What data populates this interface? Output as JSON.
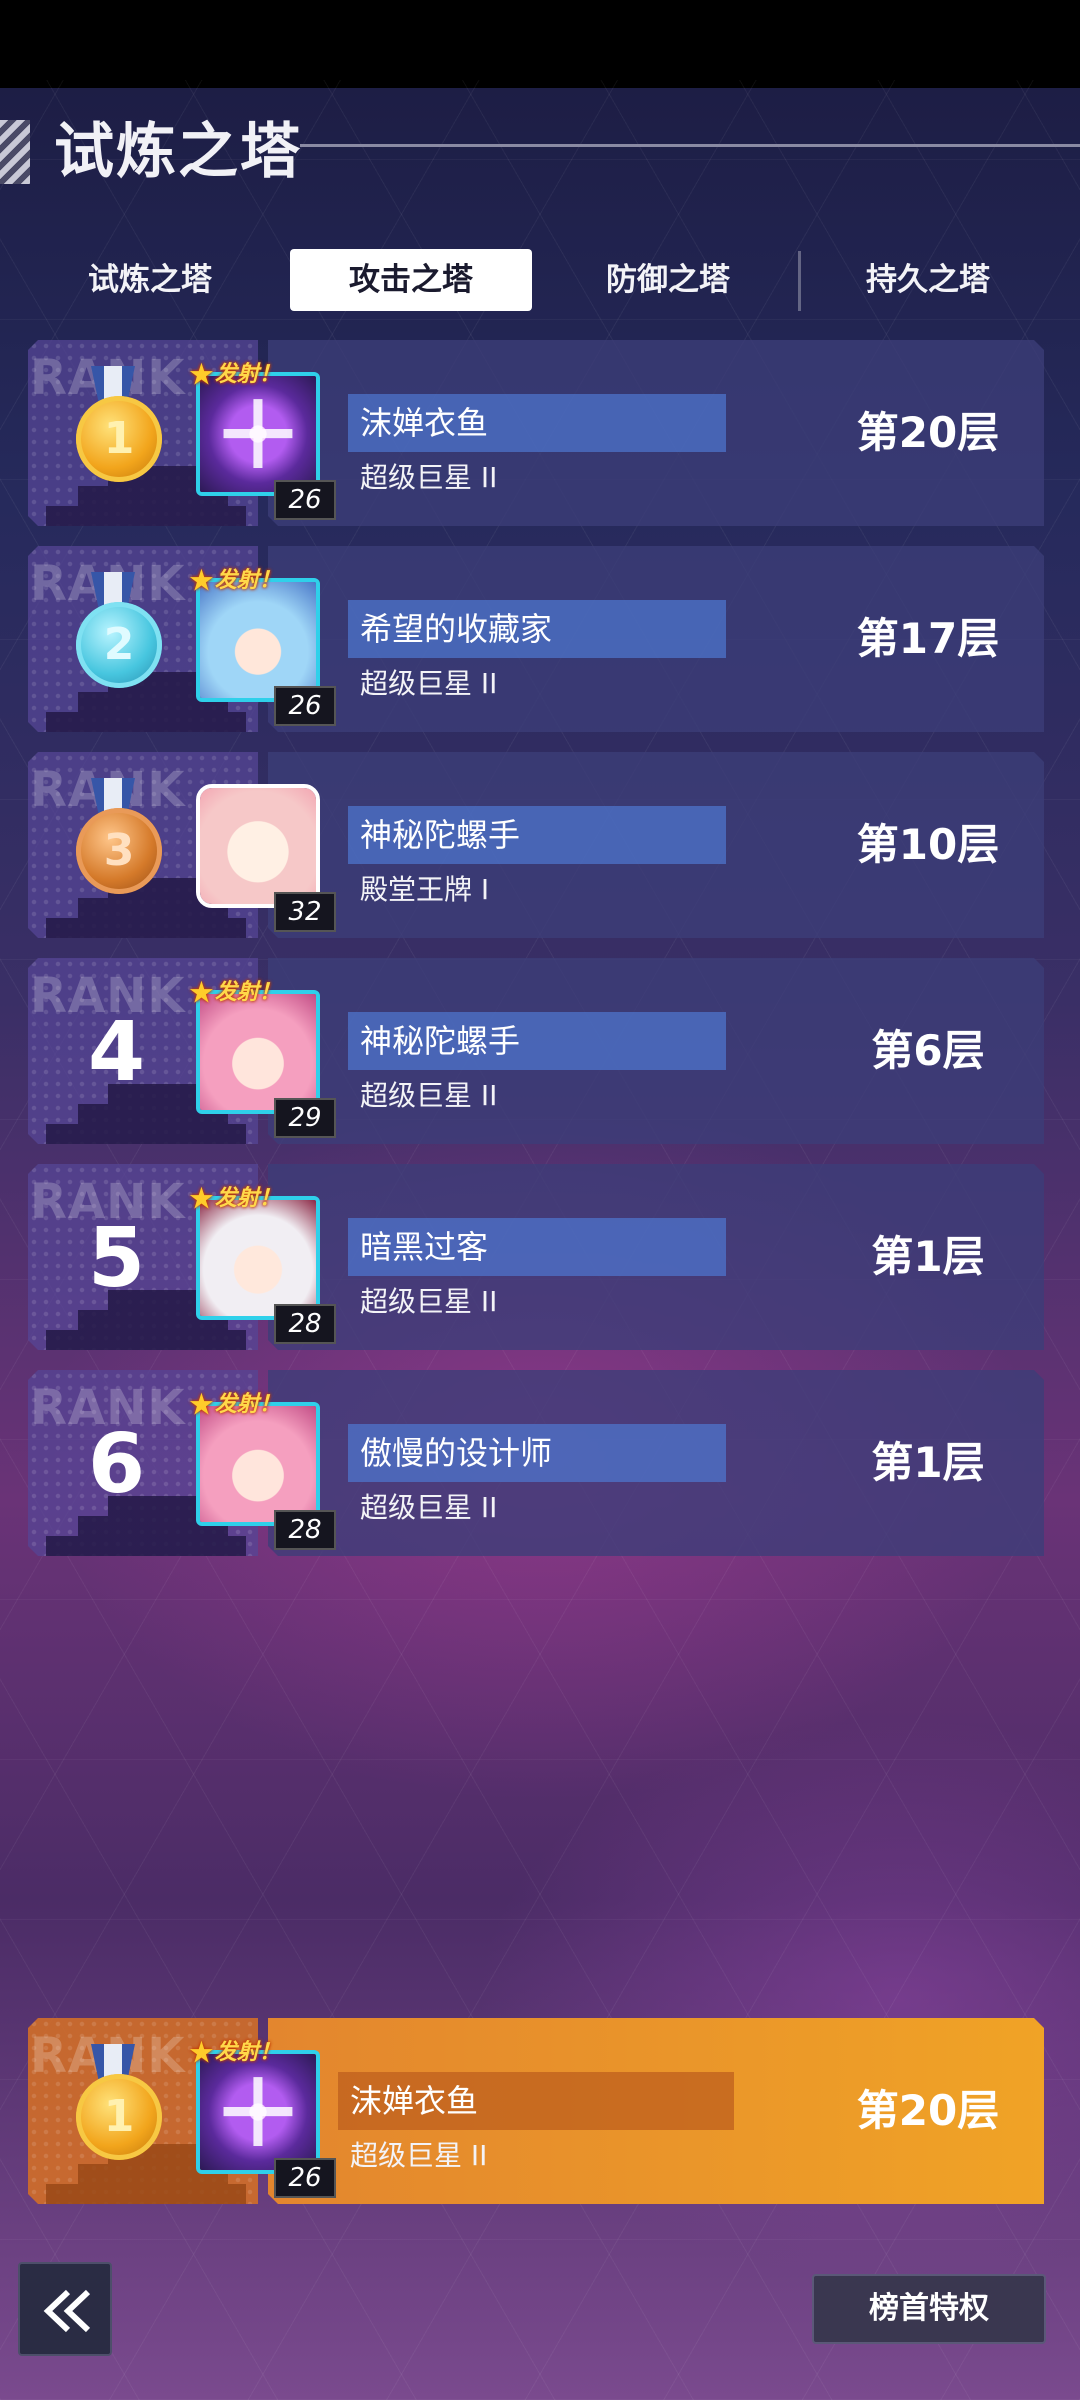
{
  "header": {
    "title": "试炼之塔"
  },
  "tabs": [
    {
      "label": "试炼之塔",
      "active": false
    },
    {
      "label": "攻击之塔",
      "active": true
    },
    {
      "label": "防御之塔",
      "active": false
    },
    {
      "label": "持久之塔",
      "active": false
    }
  ],
  "rank_watermark": "RANK",
  "hot_tag": "发射！",
  "rows": [
    {
      "rank": "1",
      "medal": "gold",
      "name": "沫婵衣鱼",
      "tier": "超级巨星 II",
      "level": "26",
      "floor": "第20层",
      "hot": true,
      "avatar": "purple-emblem"
    },
    {
      "rank": "2",
      "medal": "silver",
      "name": "希望的收藏家",
      "tier": "超级巨星 II",
      "level": "26",
      "floor": "第17层",
      "hot": true,
      "avatar": "blue-hair-girl"
    },
    {
      "rank": "3",
      "medal": "bronze",
      "name": "神秘陀螺手",
      "tier": "殿堂王牌 I",
      "level": "32",
      "floor": "第10层",
      "hot": false,
      "avatar": "chibi-girl"
    },
    {
      "rank": "4",
      "medal": null,
      "name": "神秘陀螺手",
      "tier": "超级巨星 II",
      "level": "29",
      "floor": "第6层",
      "hot": true,
      "avatar": "pink-hair-girl"
    },
    {
      "rank": "5",
      "medal": null,
      "name": "暗黑过客",
      "tier": "超级巨星 II",
      "level": "28",
      "floor": "第1层",
      "hot": true,
      "avatar": "white-hair-girl"
    },
    {
      "rank": "6",
      "medal": null,
      "name": "傲慢的设计师",
      "tier": "超级巨星 II",
      "level": "28",
      "floor": "第1层",
      "hot": true,
      "avatar": "pink-hair-girl"
    }
  ],
  "my_rank": {
    "rank": "1",
    "medal": "gold",
    "name": "沫婵衣鱼",
    "tier": "超级巨星 II",
    "level": "26",
    "floor": "第20层",
    "hot": true,
    "avatar": "purple-emblem"
  },
  "footer": {
    "back_icon": "double-chevron-left-icon",
    "privilege_label": "榜首特权"
  }
}
